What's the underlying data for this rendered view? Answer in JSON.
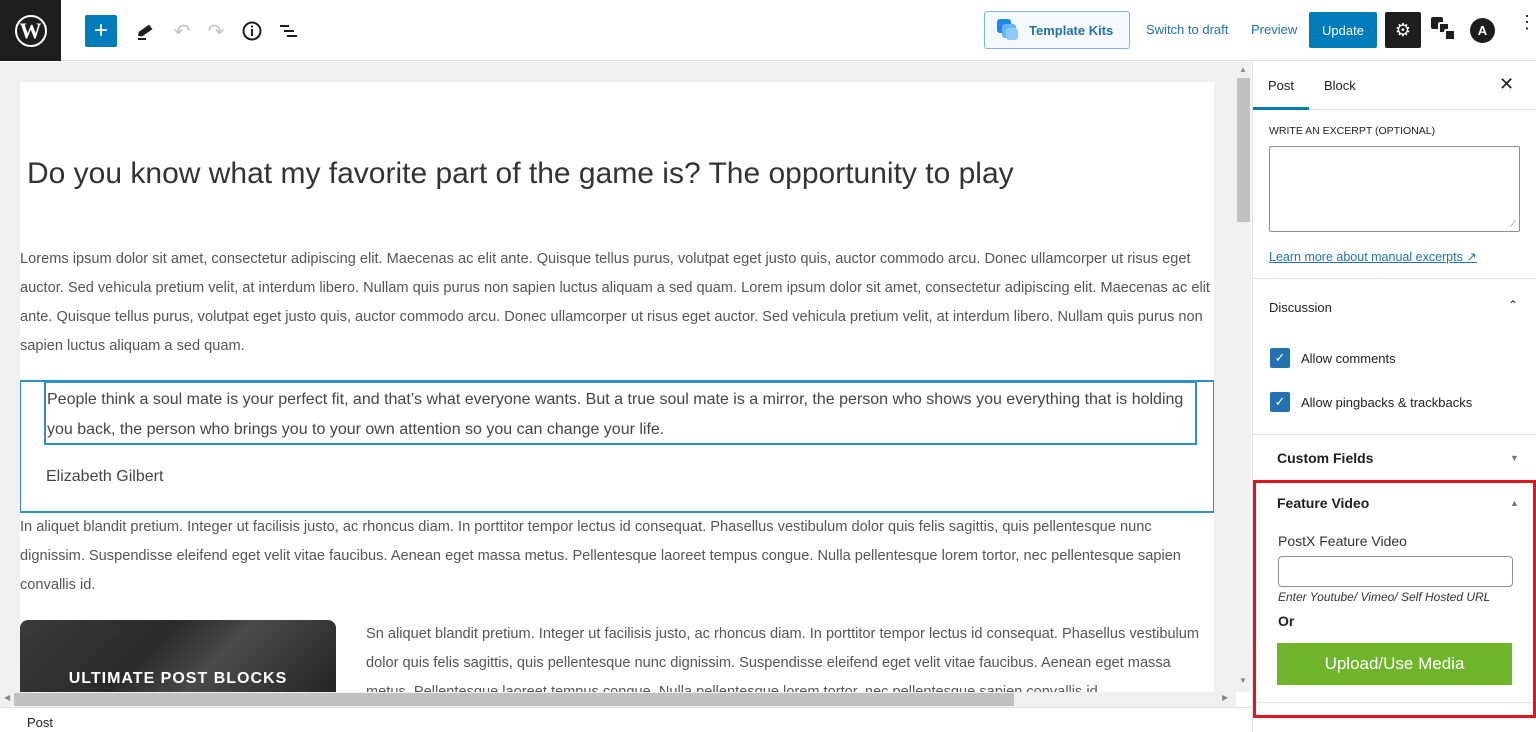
{
  "topbar": {
    "logo": "W",
    "add_block_label": "+",
    "template_kits_label": "Template Kits",
    "switch_to_draft_label": "Switch to draft",
    "preview_label": "Preview",
    "update_label": "Update",
    "icons": [
      "wordpress-logo-icon",
      "plus-icon",
      "pen-tool-icon",
      "undo-icon",
      "redo-icon",
      "info-icon",
      "list-view-icon",
      "template-kits-icon",
      "gear-icon",
      "blocks-icon",
      "astra-icon",
      "more-vertical-icon"
    ],
    "undo_glyph": "↶",
    "redo_glyph": "↷",
    "info_glyph": "ⓘ",
    "gear_glyph": "⚙",
    "astra_glyph": "A",
    "more_glyph": "⋮",
    "colors": {
      "accent": "#007cba",
      "dark": "#1e1e1e"
    }
  },
  "post": {
    "title": "Do you know what my favorite part of the game is? The opportunity to play",
    "paragraph1": "Lorems ipsum dolor sit amet, consectetur adipiscing elit. Maecenas ac elit ante. Quisque tellus purus, volutpat eget justo quis, auctor commodo arcu. Donec ullamcorper ut risus eget auctor. Sed vehicula pretium velit, at interdum libero. Nullam quis purus non sapien luctus aliquam a sed quam. Lorem ipsum dolor sit amet, consectetur adipiscing elit. Maecenas ac elit ante. Quisque tellus purus, volutpat eget justo quis, auctor commodo arcu. Donec ullamcorper ut risus eget auctor. Sed vehicula pretium velit, at interdum libero. Nullam quis purus non sapien luctus aliquam a sed quam.",
    "quote": "People think a soul mate is your perfect fit, and that’s what everyone wants. But a true soul mate is a mirror, the person who shows you everything that is holding you back, the person who brings you to your own attention so you can change your life.",
    "quote_cite": "Elizabeth Gilbert",
    "paragraph2": "In aliquet blandit pretium. Integer ut facilisis justo, ac rhoncus diam. In porttitor tempor lectus id consequat. Phasellus vestibulum dolor quis felis sagittis, quis pellentesque nunc dignissim. Suspendisse eleifend eget velit vitae faucibus. Aenean eget massa metus. Pellentesque laoreet tempus congue. Nulla pellentesque lorem tortor, nec pellentesque sapien convallis id.",
    "image_label": "ULTIMATE POST BLOCKS",
    "paragraph3": "Sn aliquet blandit pretium. Integer ut facilisis justo, ac rhoncus diam. In porttitor tempor lectus id consequat. Phasellus vestibulum dolor quis felis sagittis, quis pellentesque nunc dignissim. Suspendisse eleifend eget velit vitae faucibus. Aenean eget massa metus. Pellentesque laoreet tempus congue. Nulla pellentesque lorem tortor, nec pellentesque sapien convallis id."
  },
  "footer": {
    "breadcrumb": "Post"
  },
  "sidebar": {
    "tabs": [
      {
        "label": "Post",
        "active": true
      },
      {
        "label": "Block",
        "active": false
      }
    ],
    "close_glyph": "✕",
    "excerpt": {
      "label": "WRITE AN EXCERPT (OPTIONAL)",
      "value": "",
      "link": "Learn more about manual excerpts ↗"
    },
    "discussion": {
      "title": "Discussion",
      "expanded": true,
      "options": [
        {
          "label": "Allow comments",
          "checked": true
        },
        {
          "label": "Allow pingbacks & trackbacks",
          "checked": true
        }
      ]
    },
    "custom_fields": {
      "title": "Custom Fields",
      "expanded": false
    },
    "feature_video": {
      "title": "Feature Video",
      "expanded": true,
      "field_label": "PostX Feature Video",
      "field_value": "",
      "help_text": "Enter Youtube/ Vimeo/ Self Hosted URL",
      "or_label": "Or",
      "upload_label": "Upload/Use Media",
      "upload_color": "#6fb52c",
      "highlight_color": "#e3151a"
    },
    "check_glyph": "✓",
    "chevron_up_glyph": "⌃",
    "tri_down_glyph": "▼",
    "tri_up_glyph": "▲"
  }
}
